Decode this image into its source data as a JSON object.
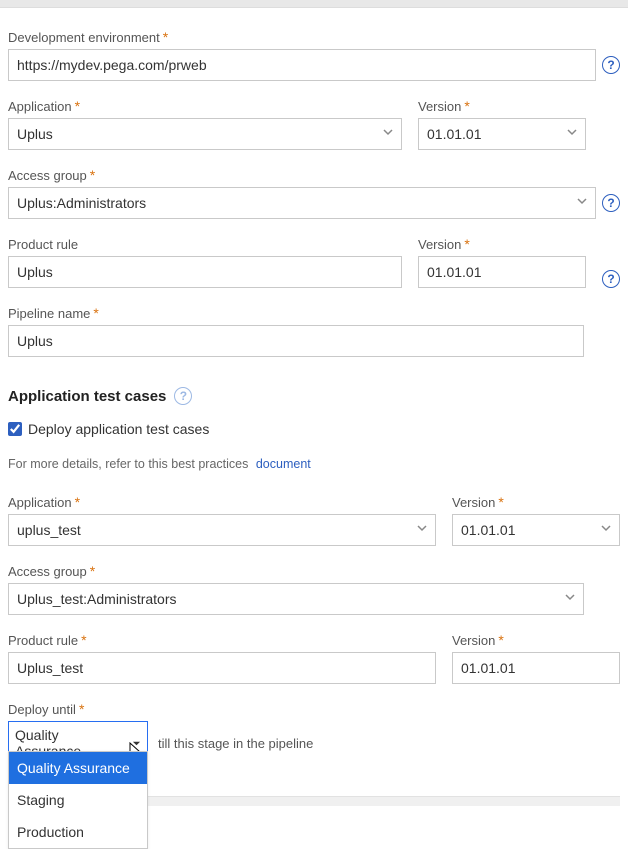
{
  "labels": {
    "dev_env": "Development environment",
    "application": "Application",
    "version": "Version",
    "access_group": "Access group",
    "product_rule": "Product rule",
    "pipeline_name": "Pipeline name",
    "test_heading": "Application test cases",
    "deploy_checkbox": "Deploy application test cases",
    "hint_text": "For more details, refer to this best practices",
    "hint_link": "document",
    "deploy_until": "Deploy until",
    "deploy_hint": "till this stage in the pipeline",
    "asterisk": "*"
  },
  "main": {
    "dev_env": "https://mydev.pega.com/prweb",
    "application": "Uplus",
    "app_version": "01.01.01",
    "access_group": "Uplus:Administrators",
    "product_rule": "Uplus",
    "product_version": "01.01.01",
    "pipeline_name": "Uplus"
  },
  "tests": {
    "deploy_checked": true,
    "application": "uplus_test",
    "app_version": "01.01.01",
    "access_group": "Uplus_test:Administrators",
    "product_rule": "Uplus_test",
    "product_version": "01.01.01",
    "deploy_selected": "Quality Assurance",
    "deploy_options": [
      "Quality Assurance",
      "Staging",
      "Production"
    ]
  }
}
